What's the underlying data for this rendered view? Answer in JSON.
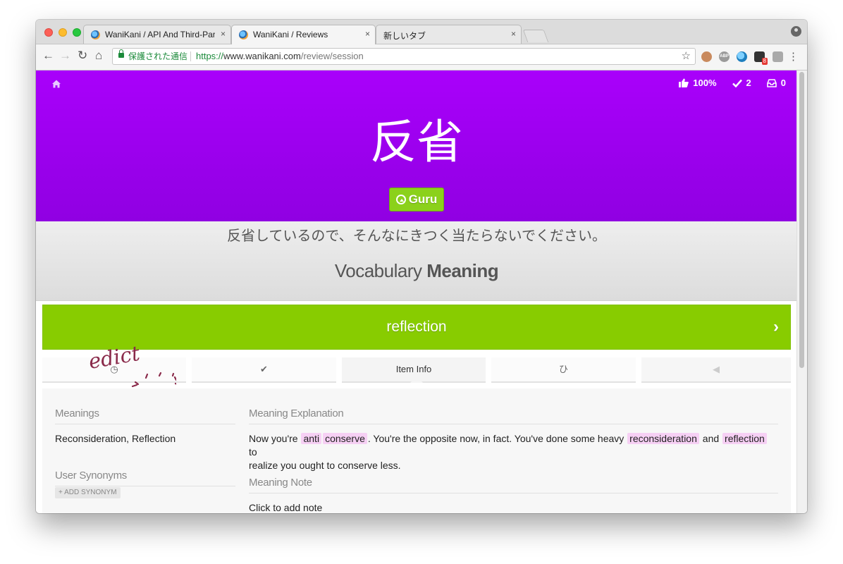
{
  "browser": {
    "tabs": [
      {
        "title": "WaniKani / API And Third-Part",
        "close": "×"
      },
      {
        "title": "WaniKani / Reviews",
        "close": "×"
      },
      {
        "title": "新しいタブ",
        "close": "×"
      }
    ],
    "nav": {
      "back": "←",
      "forward": "→",
      "reload": "↻",
      "home": "⌂"
    },
    "address": {
      "secure_label": "保護された通信",
      "scheme": "https://",
      "host": "www.wanikani.com",
      "path": "/review/session",
      "bookmark": "☆"
    },
    "extensions": [
      "face-extension-icon",
      "abp-extension-icon",
      "globe-extension-icon",
      "badge-extension-icon",
      "camera-extension-icon"
    ],
    "extension_badge": "8",
    "menu": "⋮"
  },
  "review": {
    "stats": {
      "percent": "100%",
      "completed": "2",
      "remaining": "0"
    },
    "character": "反省",
    "srs_level": "Guru",
    "context_sentence": "反省しているので、そんなにきつく当たらないでください。",
    "question_type": "Vocabulary",
    "question_category": "Meaning",
    "answer": "reflection",
    "next_glyph": "›"
  },
  "info_tabs": {
    "last_items": "◷",
    "correct": "✔",
    "item_info": "Item Info",
    "reading": "ひ",
    "audio": "◀"
  },
  "item_info": {
    "meanings_heading": "Meanings",
    "meanings": "Reconsideration, Reflection",
    "user_synonyms_heading": "User Synonyms",
    "add_synonym": "+ ADD SYNONYM",
    "meaning_explanation_heading": "Meaning Explanation",
    "explanation_parts": [
      "Now you're ",
      "anti",
      "conserve",
      ". You're the opposite now, in fact. You've done some heavy ",
      "reconsideration",
      " and ",
      "reflection",
      " to"
    ],
    "explanation_line2": "realize you ought to conserve less.",
    "meaning_note_heading": "Meaning Note",
    "meaning_note": "Click to add note"
  },
  "annotation": {
    "text": "edict"
  },
  "colors": {
    "hero": "#a000f2",
    "correct": "#88cc00",
    "highlight": "#f6d0f4"
  }
}
